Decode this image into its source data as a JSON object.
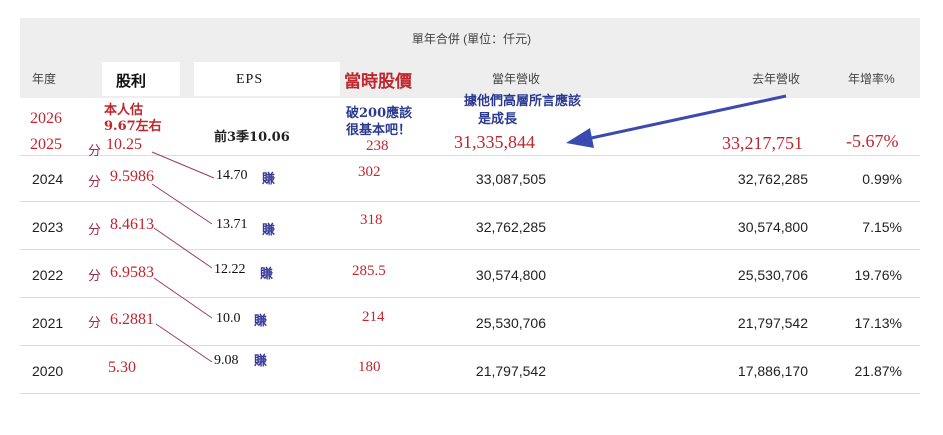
{
  "table": {
    "title": "單年合併 (單位：仟元)",
    "headers": {
      "year": "年度",
      "dividend": "股利",
      "eps": "EPS",
      "price": "當時股價",
      "revenue": "當年營收",
      "prev_revenue": "去年營收",
      "growth": "年增率%"
    },
    "rows": [
      {
        "year": "2024",
        "revenue": "33,087,505",
        "prev": "32,762,285",
        "growth": "0.99%"
      },
      {
        "year": "2023",
        "revenue": "32,762,285",
        "prev": "30,574,800",
        "growth": "7.15%"
      },
      {
        "year": "2022",
        "revenue": "30,574,800",
        "prev": "25,530,706",
        "growth": "19.76%"
      },
      {
        "year": "2021",
        "revenue": "25,530,706",
        "prev": "21,797,542",
        "growth": "17.13%"
      },
      {
        "year": "2020",
        "revenue": "21,797,542",
        "prev": "17,886,170",
        "growth": "21.87%"
      }
    ]
  },
  "handwritten": {
    "year_2026": "2026",
    "year_2025": "2025",
    "estimate_line1": "本人估",
    "estimate_line2": "9.67左右",
    "q3_eps": "前3季10.06",
    "price_comment_line1": "破200應該",
    "price_comment_line2": "很基本吧！",
    "mgmt_comment_line1": "據他們高層所言應該",
    "mgmt_comment_line2": "是成長",
    "fen": "分",
    "zhuan": "賺",
    "r2025": {
      "dividend": "10.25",
      "price": "238",
      "revenue": "31,335,844",
      "prev": "33,217,751",
      "growth": "-5.67%"
    },
    "dividends": [
      "9.5986",
      "8.4613",
      "6.9583",
      "6.2881",
      "5.30"
    ],
    "eps": [
      "14.70",
      "13.71",
      "12.22",
      "10.0",
      "9.08"
    ],
    "prices": [
      "302",
      "318",
      "285.5",
      "214",
      "180"
    ]
  }
}
